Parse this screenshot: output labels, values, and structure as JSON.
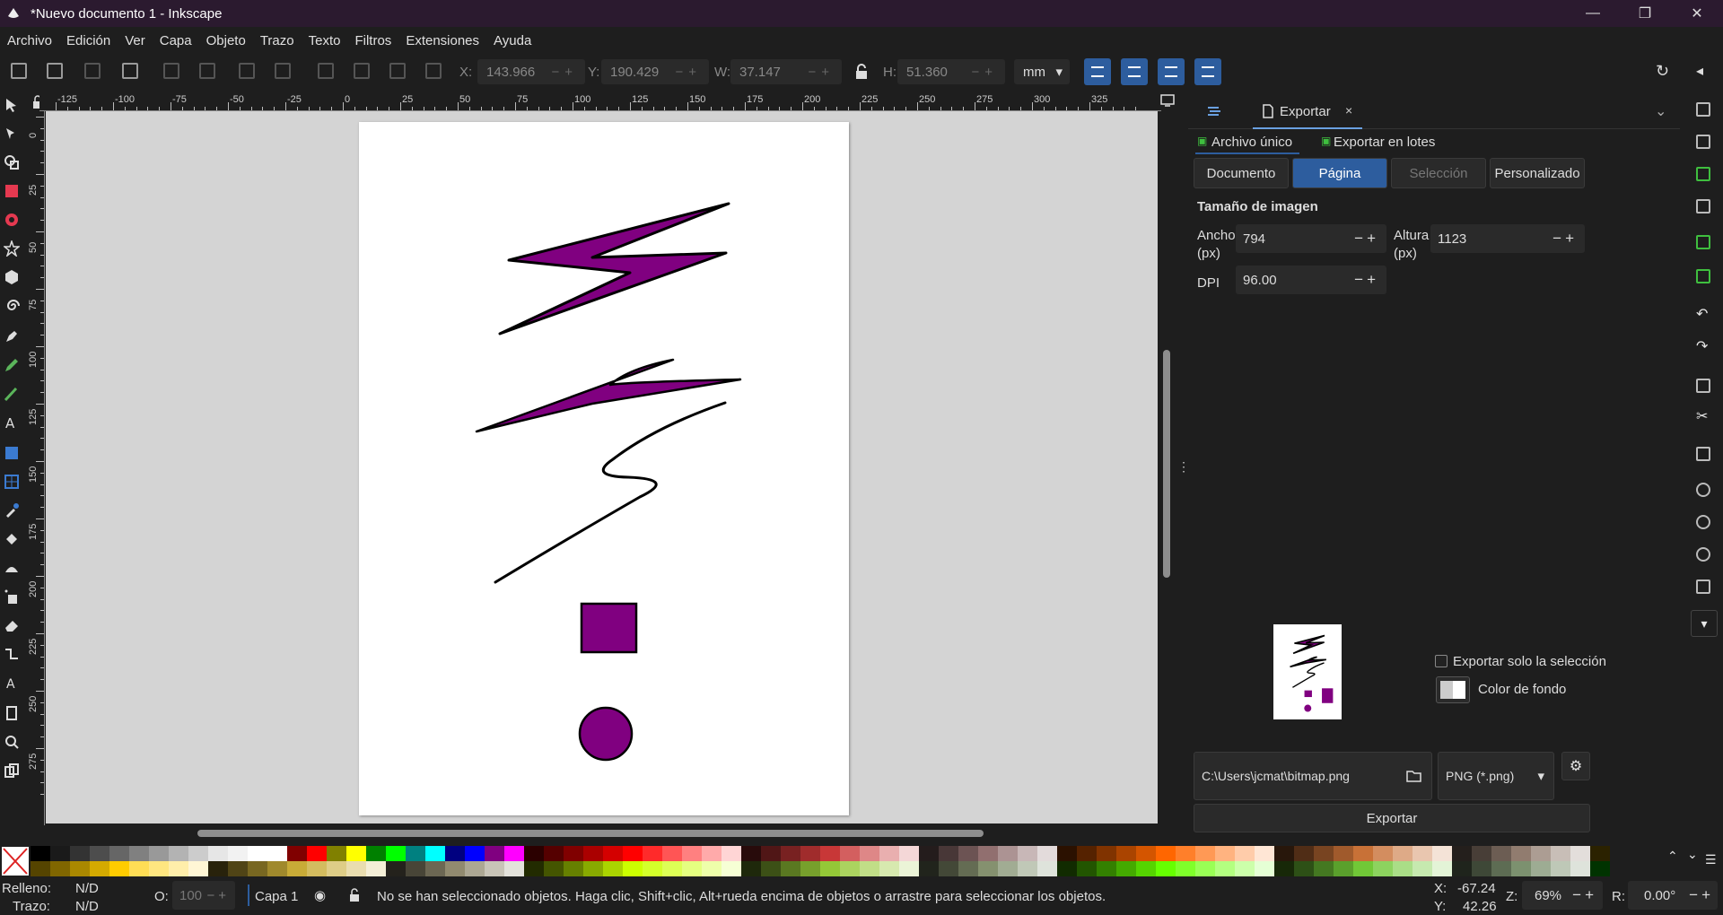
{
  "window": {
    "title": "*Nuevo documento 1 - Inkscape"
  },
  "menu": [
    "Archivo",
    "Edición",
    "Ver",
    "Capa",
    "Objeto",
    "Trazo",
    "Texto",
    "Filtros",
    "Extensiones",
    "Ayuda"
  ],
  "toolbar": {
    "x_label": "X:",
    "x_value": "143.966",
    "y_label": "Y:",
    "y_value": "190.429",
    "w_label": "W:",
    "w_value": "37.147",
    "h_label": "H:",
    "h_value": "51.360",
    "unit": "mm",
    "stepper": "−+"
  },
  "rulers": {
    "h_labels": [
      "-125",
      "-100",
      "-75",
      "-50",
      "-25",
      "0",
      "25",
      "50",
      "75",
      "100",
      "125",
      "150",
      "175",
      "200",
      "225",
      "250",
      "275",
      "300",
      "325"
    ],
    "v_labels": [
      "0",
      "25",
      "50",
      "75",
      "100",
      "125",
      "150",
      "175",
      "200",
      "225",
      "250",
      "275"
    ]
  },
  "export": {
    "tab_label": "Exportar",
    "tab_close": "×",
    "single_file": "Archivo único",
    "batch": "Exportar en lotes",
    "area_buttons": [
      "Documento",
      "Página",
      "Selección",
      "Personalizado"
    ],
    "section_title": "Tamaño de imagen",
    "width_label_1": "Ancho",
    "width_label_2": "(px)",
    "width_value": "794",
    "height_label_1": "Altura",
    "height_label_2": "(px)",
    "height_value": "1123",
    "dpi_label": "DPI",
    "dpi_value": "96.00",
    "stepper": "−+",
    "only_selection": "Exportar solo la selección",
    "bg_color": "Color de fondo",
    "filename": "C:\\Users\\jcmat\\bitmap.png",
    "format": "PNG (*.png)",
    "export_button": "Exportar"
  },
  "status": {
    "fill_label": "Relleno:",
    "fill_value": "N/D",
    "stroke_label": "Trazo:",
    "stroke_value": "N/D",
    "opacity_label": "O:",
    "opacity_value": "100",
    "layer": "Capa 1",
    "message": "No se han seleccionado objetos. Haga clic, Shift+clic, Alt+rueda encima de objetos o arrastre para seleccionar los objetos.",
    "x_label": "X:",
    "x_value": "-67.24",
    "y_label": "Y:",
    "y_value": "42.26",
    "zoom_label": "Z:",
    "zoom_value": "69%",
    "rot_label": "R:",
    "rot_value": "0.00°",
    "stepper": "−+"
  },
  "colors": {
    "accent": "#2d5d9e",
    "shape_fill": "#800080",
    "palette_top": [
      "#000000",
      "#1a1a1a",
      "#333333",
      "#4d4d4d",
      "#666666",
      "#808080",
      "#999999",
      "#b3b3b3",
      "#cccccc",
      "#e6e6e6",
      "#f2f2f2",
      "#ffffff",
      "#ffffff",
      "#800000",
      "#ff0000",
      "#808000",
      "#ffff00",
      "#008000",
      "#00ff00",
      "#008080",
      "#00ffff",
      "#000080",
      "#0000ff",
      "#800080",
      "#ff00ff",
      "#2b0000",
      "#550000",
      "#800000",
      "#aa0000",
      "#d40000",
      "#ff0000",
      "#ff2a2a",
      "#ff5555",
      "#ff8080",
      "#ffaaaa",
      "#ffd5d5",
      "#280b0b",
      "#501616",
      "#782121",
      "#a02c2c",
      "#c83737",
      "#d35f5f",
      "#de8787",
      "#e9afaf",
      "#f4d7d7",
      "#241c1c",
      "#483737",
      "#6c5353",
      "#916f6f",
      "#ac9393",
      "#c8b7b7",
      "#e3dbdb",
      "#2b1100",
      "#552200",
      "#803300",
      "#aa4400",
      "#d45500",
      "#ff6600",
      "#ff7f2a",
      "#ff9955",
      "#ffb380",
      "#ffccaa",
      "#ffe6d5",
      "#28170b",
      "#502d16",
      "#784421",
      "#a05a2c",
      "#c87137",
      "#d38d5f",
      "#deaa87",
      "#e9c6af",
      "#f4e3d7",
      "#241f1c",
      "#483e37",
      "#6c5d53",
      "#917c6f",
      "#ac9d93",
      "#c8beb7",
      "#e3dedb",
      "#2b2200"
    ],
    "palette_bottom": [
      "#554400",
      "#806600",
      "#aa8800",
      "#d4aa00",
      "#ffcc00",
      "#ffdd55",
      "#ffe680",
      "#ffeeaa",
      "#fff6d5",
      "#28220b",
      "#504416",
      "#786721",
      "#a0892c",
      "#c8ab37",
      "#d3bc5f",
      "#decd87",
      "#e9ddaf",
      "#f4eed7",
      "#24221c",
      "#484537",
      "#6c6753",
      "#918a6f",
      "#aca793",
      "#c8c4b7",
      "#e3e2db",
      "#222b00",
      "#445500",
      "#668000",
      "#88aa00",
      "#aad400",
      "#ccff00",
      "#d4ff2a",
      "#ddff55",
      "#e5ff80",
      "#eeffaa",
      "#f6ffd5",
      "#1e280b",
      "#3c5016",
      "#5a7821",
      "#77a02c",
      "#94c837",
      "#abd35f",
      "#c1de87",
      "#d7e9af",
      "#ebf4d7",
      "#21241c",
      "#434837",
      "#646c53",
      "#85916f",
      "#a1ac93",
      "#c0c8b7",
      "#dee3db",
      "#112b00",
      "#225500",
      "#338000",
      "#44aa00",
      "#55d400",
      "#66ff00",
      "#7fff2a",
      "#99ff55",
      "#b3ff80",
      "#ccffaa",
      "#e5ffd5",
      "#172808",
      "#2d5016",
      "#447821",
      "#5aa02c",
      "#71c837",
      "#8dd35f",
      "#aade87",
      "#c6e9af",
      "#e3f4d7",
      "#1f241c",
      "#3e4837",
      "#5d6c53",
      "#7c916f",
      "#9dac93",
      "#bec8b7",
      "#dee3db",
      "#003300"
    ]
  },
  "icons": {
    "app": "inkscape-logo-icon",
    "window_controls": [
      "minimize-icon",
      "restore-icon",
      "close-icon"
    ]
  }
}
